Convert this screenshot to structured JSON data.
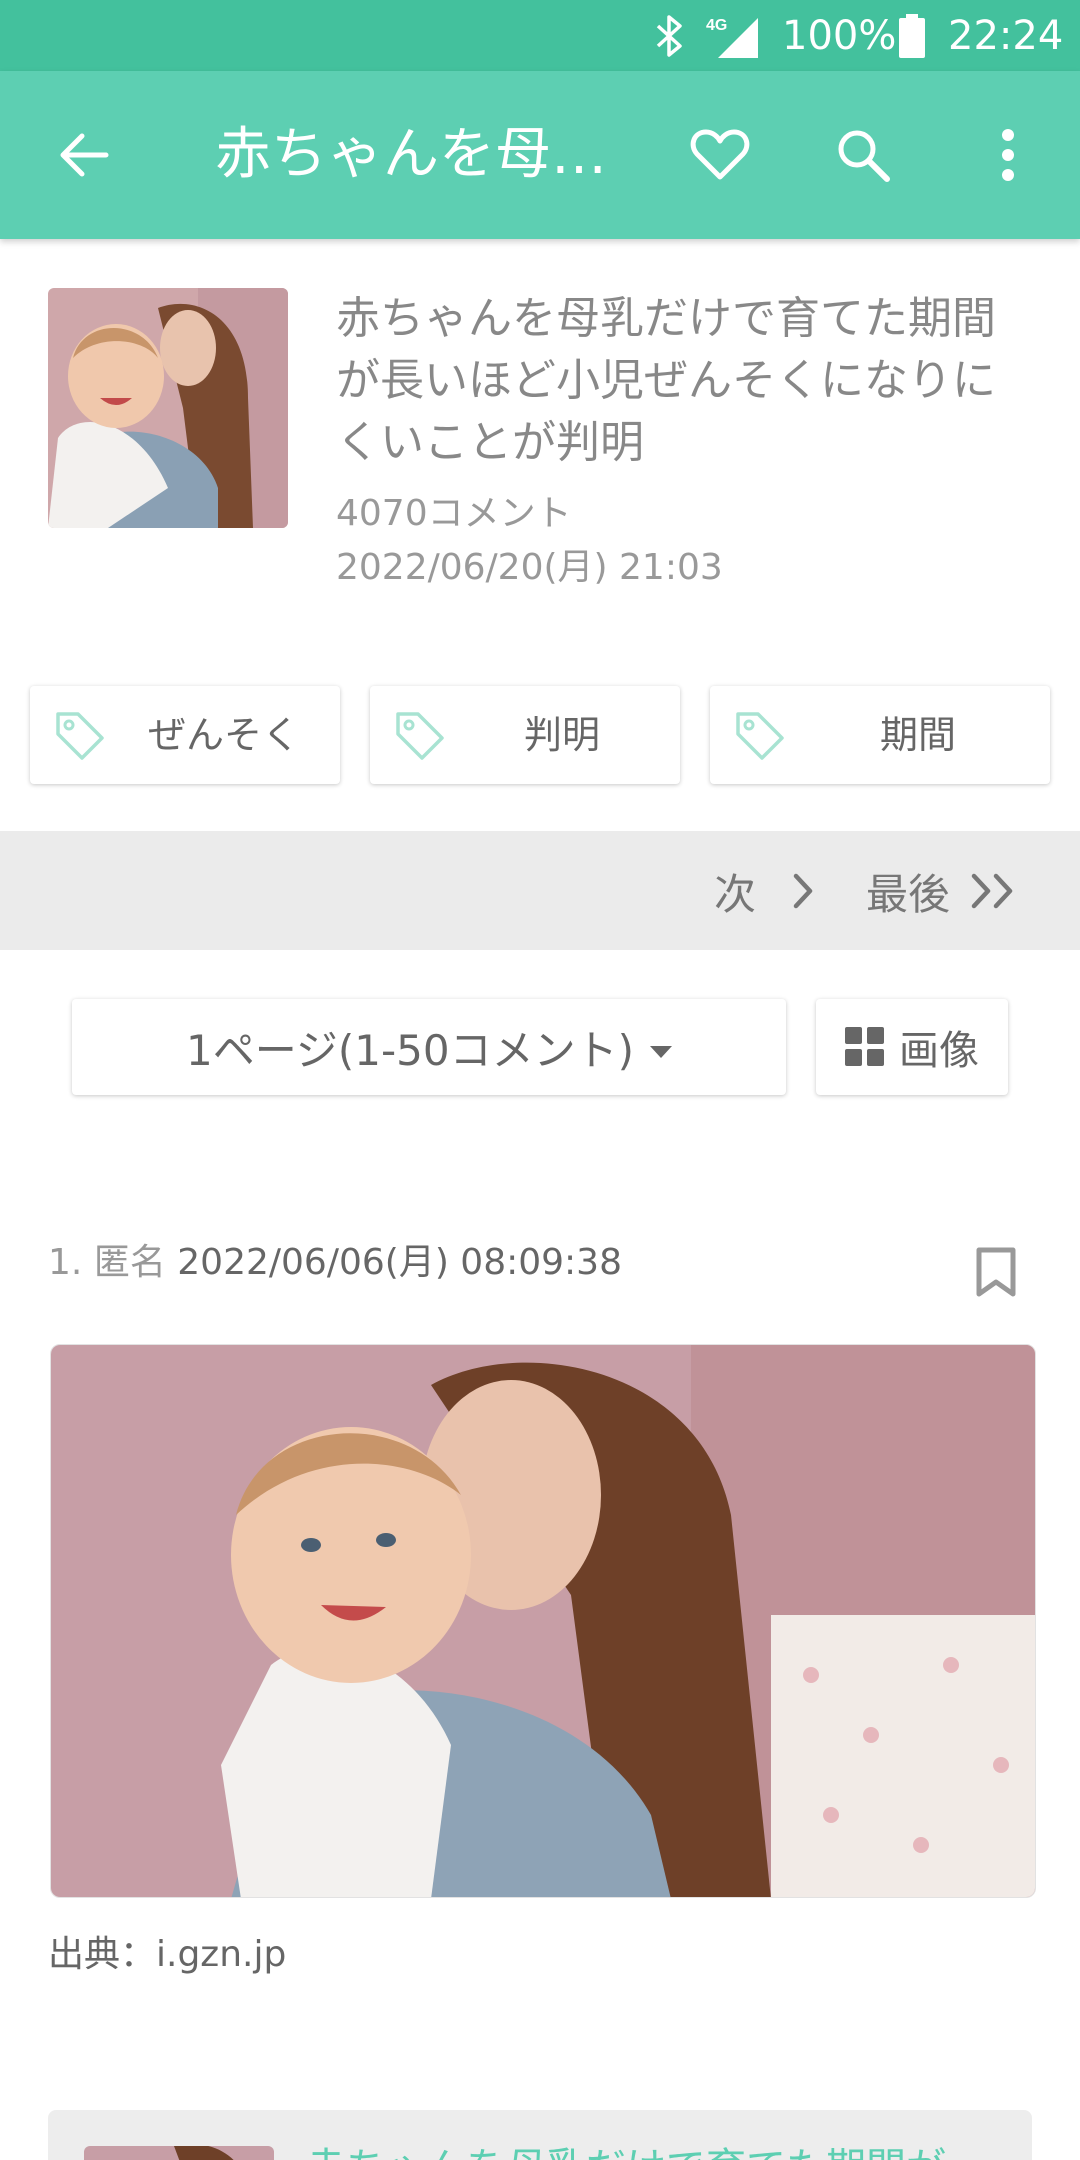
{
  "status_bar": {
    "network": "4G",
    "battery": "100%",
    "time": "22:24"
  },
  "app_bar": {
    "title": "赤ちゃんを母…"
  },
  "article": {
    "headline": "赤ちゃんを母乳だけで育てた期間が長いほど小児ぜんそくになりにくいことが判明",
    "comment_count": "4070コメント",
    "date": "2022/06/20(月) 21:03"
  },
  "tags": [
    {
      "label": "ぜんそく"
    },
    {
      "label": "判明"
    },
    {
      "label": "期間"
    }
  ],
  "pager": {
    "next": "次",
    "last": "最後"
  },
  "page_select": {
    "label": "1ページ(1-50コメント)"
  },
  "image_button": {
    "label": "画像"
  },
  "comment": {
    "number": "1.",
    "author": "匿名",
    "date": "2022/06/06(月) 08:09:38",
    "source": "出典：i.gzn.jp"
  },
  "related": {
    "title": "赤ちゃんを母乳だけで育てた期間が"
  },
  "colors": {
    "status_bar": "#43c19d",
    "app_bar": "#5dcfb2",
    "accent": "#5dcfb2"
  },
  "icons": [
    "back-arrow-icon",
    "heart-icon",
    "search-icon",
    "more-vert-icon",
    "tag-icon",
    "chevron-right-icon",
    "double-chevron-right-icon",
    "caret-down-icon",
    "grid-icon",
    "bookmark-icon",
    "bluetooth-icon",
    "signal-icon",
    "battery-icon"
  ]
}
